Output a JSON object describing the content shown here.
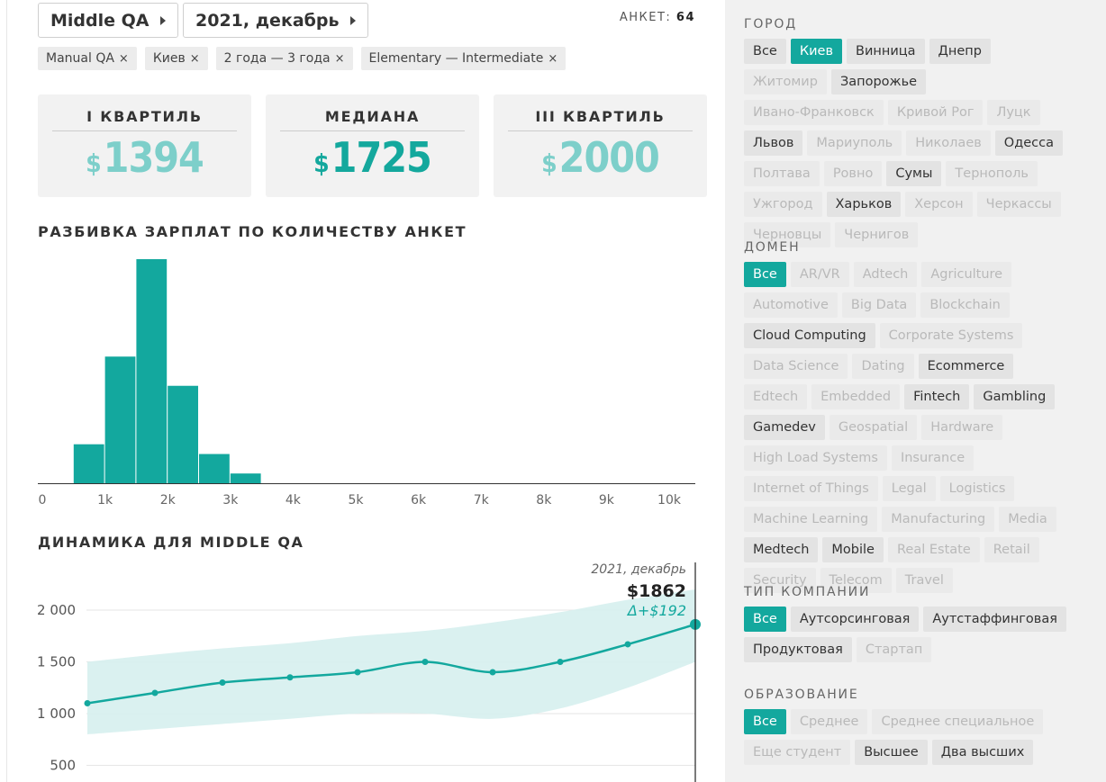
{
  "header": {
    "position_label": "Middle QA",
    "period_label": "2021, декабрь",
    "ankety_label": "АНКЕТ:",
    "ankety_count": "64"
  },
  "filters_applied": [
    {
      "label": "Manual QA",
      "x": "×"
    },
    {
      "label": "Киев",
      "x": "×"
    },
    {
      "label": "2 года — 3 года",
      "x": "×"
    },
    {
      "label": "Elementary — Intermediate",
      "x": "×"
    }
  ],
  "quartiles": [
    {
      "title": "I КВАРТИЛЬ",
      "currency": "$",
      "value": "1394"
    },
    {
      "title": "МЕДИАНА",
      "currency": "$",
      "value": "1725"
    },
    {
      "title": "III КВАРТИЛЬ",
      "currency": "$",
      "value": "2000"
    }
  ],
  "histogram_title": "РАЗБИВКА ЗАРПЛАТ ПО КОЛИЧЕСТВУ АНКЕТ",
  "dynamics_title": "ДИНАМИКА ДЛЯ MIDDLE QA",
  "tooltip": {
    "date": "2021, декабрь",
    "value": "$1862",
    "delta": "Δ+$192"
  },
  "chart_data": [
    {
      "type": "bar",
      "title": "РАЗБИВКА ЗАРПЛАТ ПО КОЛИЧЕСТВУ АНКЕТ",
      "bin_width": 500,
      "bins_start": [
        500,
        1000,
        1500,
        2000,
        2500,
        3000
      ],
      "values": [
        4,
        13,
        23,
        10,
        3,
        1
      ],
      "xticks": [
        "0",
        "1k",
        "2k",
        "3k",
        "4k",
        "5k",
        "6k",
        "7k",
        "8k",
        "9k",
        "10k"
      ],
      "xlim": [
        0,
        10500
      ],
      "color": "#13a89e"
    },
    {
      "type": "line",
      "title": "ДИНАМИКА ДЛЯ MIDDLE QA",
      "x_index": [
        0,
        1,
        2,
        3,
        4,
        5,
        6,
        7,
        8,
        9
      ],
      "values": [
        1100,
        1200,
        1300,
        1350,
        1400,
        1500,
        1400,
        1500,
        1670,
        1862
      ],
      "band_low": [
        800,
        850,
        900,
        950,
        1000,
        1000,
        950,
        1050,
        1250,
        1500
      ],
      "band_high": [
        1500,
        1570,
        1630,
        1680,
        1750,
        1800,
        1880,
        1980,
        2100,
        2200
      ],
      "yticks": [
        "2 000",
        "1 500",
        "1 000",
        "500"
      ],
      "ytick_values": [
        2000,
        1500,
        1000,
        500
      ],
      "color": "#13a89e",
      "band_color": "#d6efee"
    }
  ],
  "sidebar": {
    "city": {
      "title": "ГОРОД",
      "items": [
        {
          "label": "Все",
          "state": "on"
        },
        {
          "label": "Киев",
          "state": "sel"
        },
        {
          "label": "Винница",
          "state": "on"
        },
        {
          "label": "Днепр",
          "state": "on"
        },
        {
          "label": "Житомир",
          "state": "off"
        },
        {
          "label": "Запорожье",
          "state": "on"
        },
        {
          "label": "Ивано-Франковск",
          "state": "off"
        },
        {
          "label": "Кривой Рог",
          "state": "off"
        },
        {
          "label": "Луцк",
          "state": "off"
        },
        {
          "label": "Львов",
          "state": "on"
        },
        {
          "label": "Мариуполь",
          "state": "off"
        },
        {
          "label": "Николаев",
          "state": "off"
        },
        {
          "label": "Одесса",
          "state": "on"
        },
        {
          "label": "Полтава",
          "state": "off"
        },
        {
          "label": "Ровно",
          "state": "off"
        },
        {
          "label": "Сумы",
          "state": "on"
        },
        {
          "label": "Тернополь",
          "state": "off"
        },
        {
          "label": "Ужгород",
          "state": "off"
        },
        {
          "label": "Харьков",
          "state": "on"
        },
        {
          "label": "Херсон",
          "state": "off"
        },
        {
          "label": "Черкассы",
          "state": "off"
        },
        {
          "label": "Черновцы",
          "state": "off"
        },
        {
          "label": "Чернигов",
          "state": "off"
        }
      ]
    },
    "domain": {
      "title": "ДОМЕН",
      "items": [
        {
          "label": "Все",
          "state": "sel"
        },
        {
          "label": "AR/VR",
          "state": "off"
        },
        {
          "label": "Adtech",
          "state": "off"
        },
        {
          "label": "Agriculture",
          "state": "off"
        },
        {
          "label": "Automotive",
          "state": "off"
        },
        {
          "label": "Big Data",
          "state": "off"
        },
        {
          "label": "Blockchain",
          "state": "off"
        },
        {
          "label": "Cloud Computing",
          "state": "on"
        },
        {
          "label": "Corporate Systems",
          "state": "off"
        },
        {
          "label": "Data Science",
          "state": "off"
        },
        {
          "label": "Dating",
          "state": "off"
        },
        {
          "label": "Ecommerce",
          "state": "on"
        },
        {
          "label": "Edtech",
          "state": "off"
        },
        {
          "label": "Embedded",
          "state": "off"
        },
        {
          "label": "Fintech",
          "state": "on"
        },
        {
          "label": "Gambling",
          "state": "on"
        },
        {
          "label": "Gamedev",
          "state": "on"
        },
        {
          "label": "Geospatial",
          "state": "off"
        },
        {
          "label": "Hardware",
          "state": "off"
        },
        {
          "label": "High Load Systems",
          "state": "off"
        },
        {
          "label": "Insurance",
          "state": "off"
        },
        {
          "label": "Internet of Things",
          "state": "off"
        },
        {
          "label": "Legal",
          "state": "off"
        },
        {
          "label": "Logistics",
          "state": "off"
        },
        {
          "label": "Machine Learning",
          "state": "off"
        },
        {
          "label": "Manufacturing",
          "state": "off"
        },
        {
          "label": "Media",
          "state": "off"
        },
        {
          "label": "Medtech",
          "state": "on"
        },
        {
          "label": "Mobile",
          "state": "on"
        },
        {
          "label": "Real Estate",
          "state": "off"
        },
        {
          "label": "Retail",
          "state": "off"
        },
        {
          "label": "Security",
          "state": "off"
        },
        {
          "label": "Telecom",
          "state": "off"
        },
        {
          "label": "Travel",
          "state": "off"
        }
      ]
    },
    "company_type": {
      "title": "ТИП КОМПАНИИ",
      "items": [
        {
          "label": "Все",
          "state": "sel"
        },
        {
          "label": "Аутсорсинговая",
          "state": "on"
        },
        {
          "label": "Аутстаффинговая",
          "state": "on"
        },
        {
          "label": "Продуктовая",
          "state": "on"
        },
        {
          "label": "Стартап",
          "state": "off"
        }
      ]
    },
    "education": {
      "title": "ОБРАЗОВАНИЕ",
      "items": [
        {
          "label": "Все",
          "state": "sel"
        },
        {
          "label": "Среднее",
          "state": "off"
        },
        {
          "label": "Среднее специальное",
          "state": "off"
        },
        {
          "label": "Еще студент",
          "state": "off"
        },
        {
          "label": "Высшее",
          "state": "on"
        },
        {
          "label": "Два высших",
          "state": "on"
        }
      ]
    }
  }
}
